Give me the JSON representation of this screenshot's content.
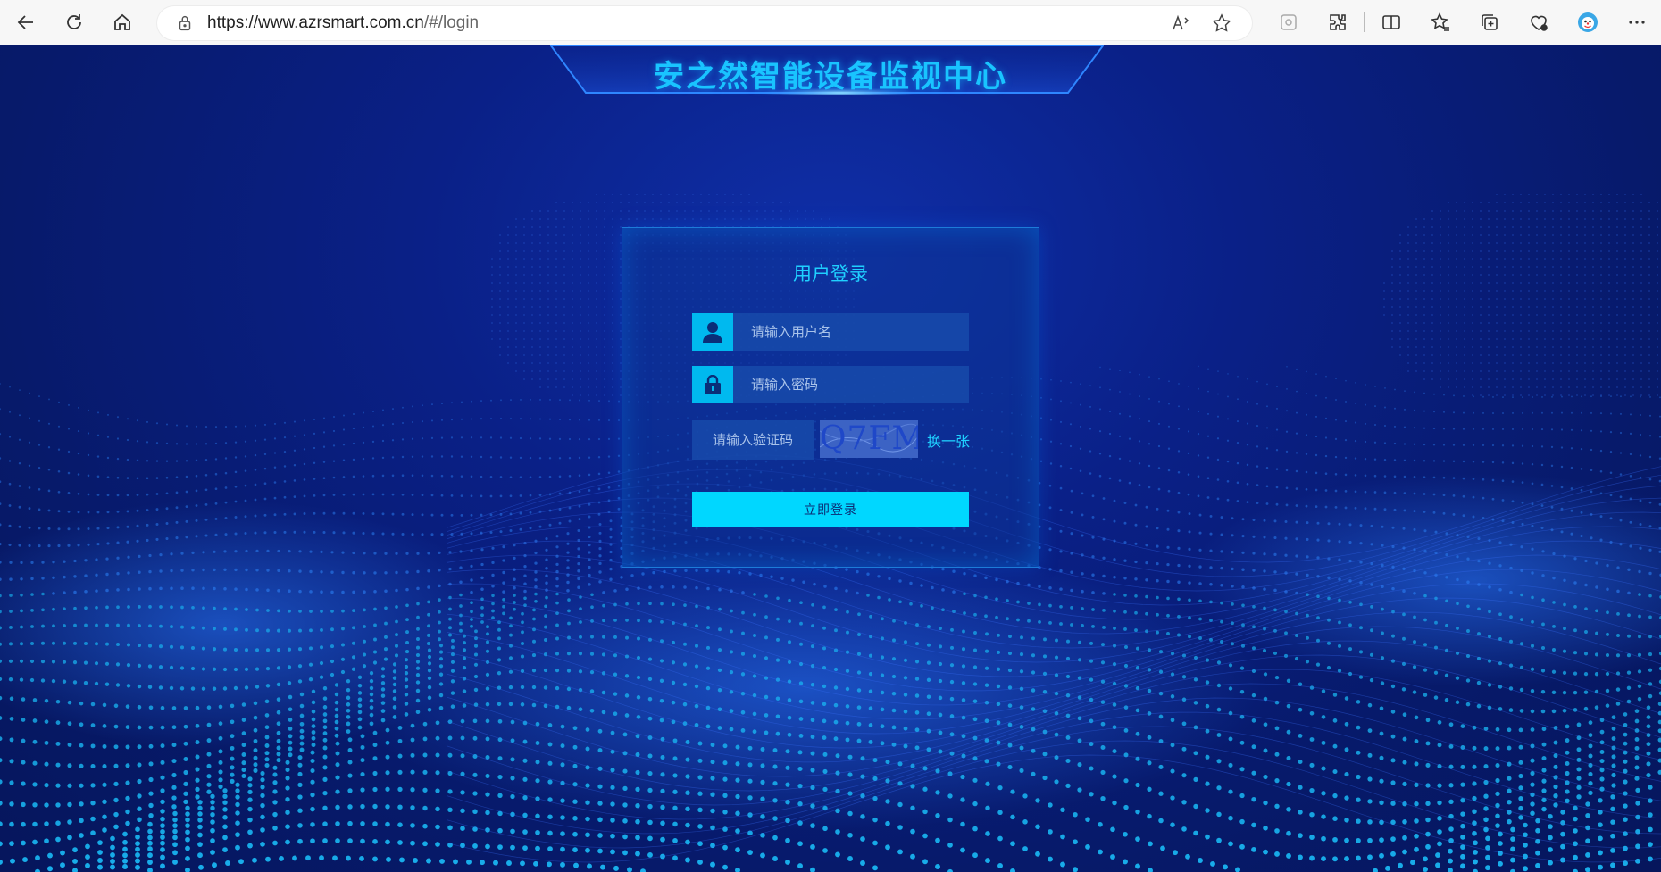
{
  "browser": {
    "url_main": "https://www.azrsmart.com.cn",
    "url_rest": "/#/login"
  },
  "page": {
    "title": "安之然智能设备监视中心"
  },
  "login": {
    "heading": "用户登录",
    "username_placeholder": "请输入用户名",
    "password_placeholder": "请输入密码",
    "captcha_placeholder": "请输入验证码",
    "captcha_code": "Q7FM",
    "refresh_label": "换一张",
    "submit_label": "立即登录"
  },
  "colors": {
    "accent": "#00d7ff",
    "title": "#19c4ff",
    "background": "#0a2087"
  },
  "icons": [
    "back-arrow-icon",
    "refresh-icon",
    "home-icon",
    "lock-icon",
    "read-aloud-icon",
    "favorite-star-icon",
    "app-icon",
    "extensions-icon",
    "split-screen-icon",
    "favorites-icon",
    "collections-icon",
    "performance-icon",
    "profile-avatar-icon",
    "more-menu-icon",
    "user-icon",
    "padlock-icon"
  ]
}
